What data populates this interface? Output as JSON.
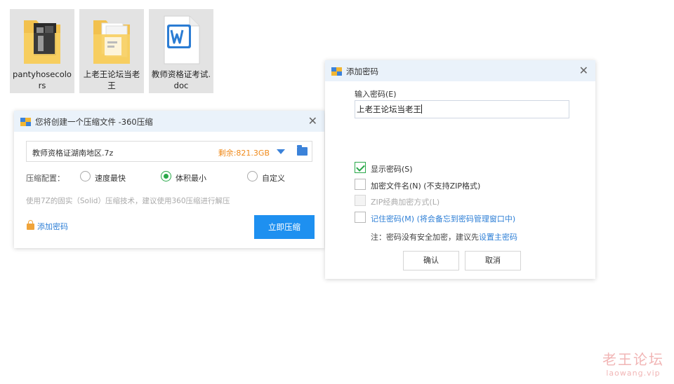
{
  "desktop": {
    "icons": [
      {
        "label": "pantyhosecolors"
      },
      {
        "label": "上老王论坛当老王"
      },
      {
        "label": "教师资格证考试.doc"
      }
    ]
  },
  "compress_dialog": {
    "title": "您将创建一个压缩文件 -360压缩",
    "filename": "教师资格证湖南地区.7z",
    "space_left": "剩余:821.3GB",
    "config_label": "压缩配置：",
    "options": [
      {
        "label": "速度最快",
        "selected": false
      },
      {
        "label": "体积最小",
        "selected": true
      },
      {
        "label": "自定义",
        "selected": false
      }
    ],
    "hint": "使用7Z的固实（Solid）压缩技术，建议使用360压缩进行解压",
    "add_password": "添加密码",
    "compress_now": "立即压缩"
  },
  "password_dialog": {
    "title": "添加密码",
    "field_label": "输入密码(E)",
    "password_value": "上老王论坛当老王",
    "checkboxes": [
      {
        "label": "显示密码(S)",
        "checked": true,
        "disabled": false
      },
      {
        "label": "加密文件名(N) (不支持ZIP格式)",
        "checked": false,
        "disabled": false
      },
      {
        "label": "ZIP经典加密方式(L)",
        "checked": false,
        "disabled": true
      },
      {
        "label": "记住密码(M) (将会备忘到密码管理窗口中)",
        "checked": false,
        "disabled": false
      }
    ],
    "note_prefix": "注：密码没有安全加密，建议先",
    "note_link": "设置主密码",
    "ok": "确认",
    "cancel": "取消"
  },
  "watermark": {
    "main": "老王论坛",
    "sub": "laowang.vip"
  },
  "colors": {
    "accent": "#1e90f0",
    "link": "#2e7fd6",
    "warning": "#f08a1a",
    "check_green": "#2aa84a",
    "titlebar": "#eaf2fa"
  }
}
